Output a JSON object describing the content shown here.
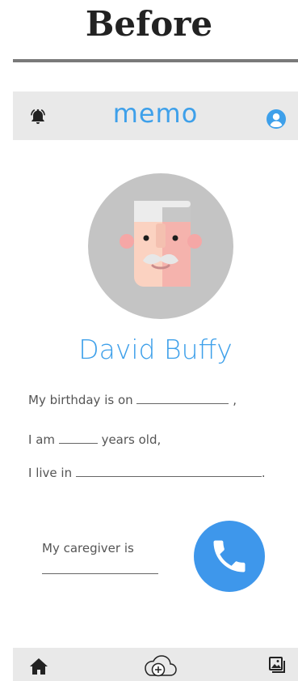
{
  "heading": "Before",
  "app": {
    "title": "memo"
  },
  "profile": {
    "name": "David Buffy"
  },
  "form": {
    "birthday_prefix": "My birthday is on",
    "birthday_suffix": ",",
    "age_prefix": "I am",
    "age_suffix": "years old,",
    "live_prefix": "I live in",
    "live_suffix": ".",
    "caregiver_label": "My caregiver is"
  },
  "icons": {
    "top_left": "bell-icon",
    "top_right": "user-icon",
    "call": "phone-icon",
    "nav": [
      "home-icon",
      "cloud-upload-icon",
      "gallery-icon"
    ]
  },
  "colors": {
    "accent": "#3ea0ea",
    "bar": "#e9e9e9",
    "call": "#3e97eb"
  }
}
